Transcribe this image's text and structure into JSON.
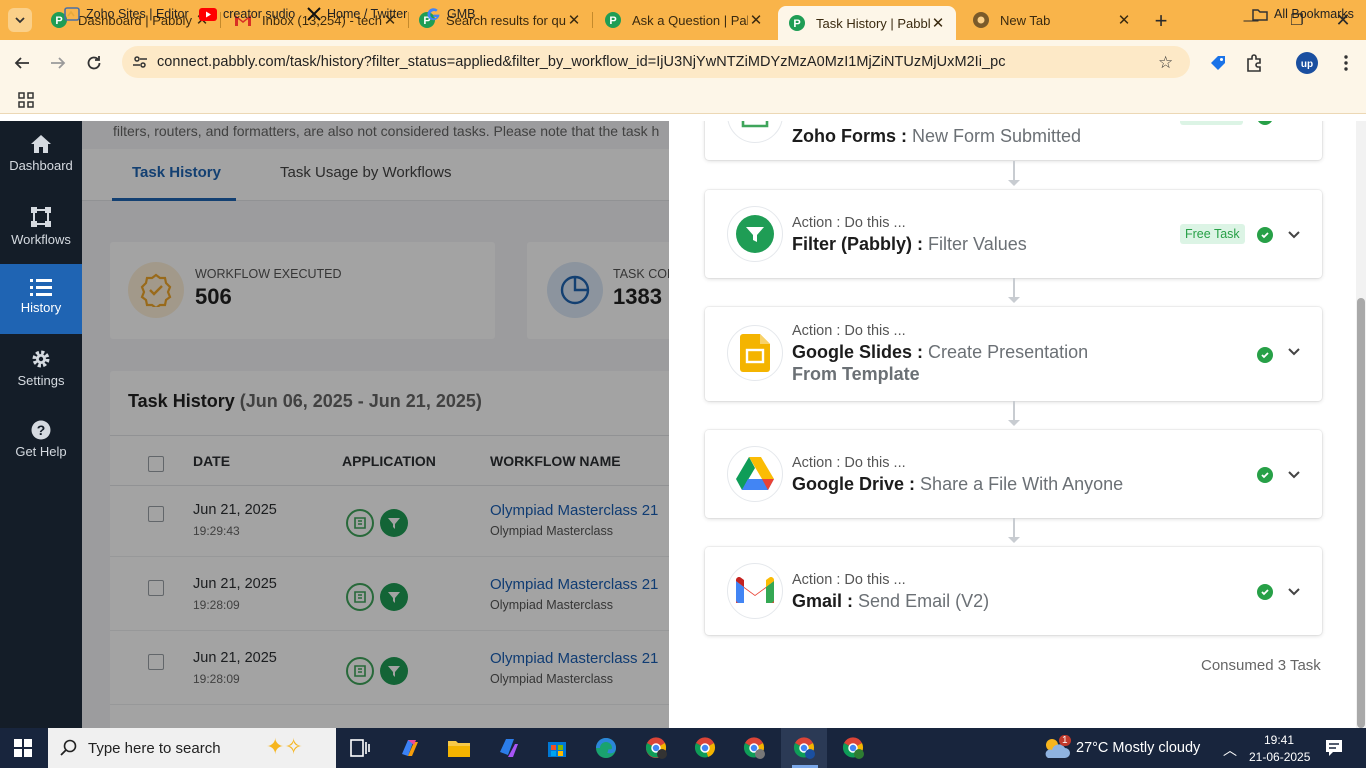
{
  "browser": {
    "tabs": [
      {
        "title": "Dashboard | Pabbly C",
        "icon": "pabbly-icon"
      },
      {
        "title": "Inbox (13,254) - tech",
        "icon": "gmail-icon"
      },
      {
        "title": "Search results for que",
        "icon": "pabbly-icon"
      },
      {
        "title": "Ask a Question | Pabb",
        "icon": "pabbly-icon"
      },
      {
        "title": "Task History | Pabbly",
        "icon": "pabbly-icon"
      },
      {
        "title": "New Tab",
        "icon": "chrome-icon"
      }
    ],
    "url": "connect.pabbly.com/task/history?filter_status=applied&filter_by_workflow_id=IjU3NjYwNTZiMDYzMzA0MzI1MjZiNTUzMjUxM2Ii_pc",
    "bookmarks": [
      "Zoho Sites | Editor",
      "creator sudio",
      "Home / Twitter",
      "GMB"
    ],
    "all_bookmarks": "All Bookmarks"
  },
  "sidebar": {
    "items": [
      {
        "label": "Dashboard"
      },
      {
        "label": "Workflows"
      },
      {
        "label": "History"
      },
      {
        "label": "Settings"
      },
      {
        "label": "Get Help"
      }
    ]
  },
  "page": {
    "intro_text": "filters, routers, and formatters, are also not considered tasks. Please note that the task h",
    "tabs": [
      "Task History",
      "Task Usage by Workflows"
    ],
    "stats": [
      {
        "label": "WORKFLOW EXECUTED",
        "value": "506"
      },
      {
        "label": "TASK CON",
        "value": "1383"
      }
    ],
    "history_title": "Task History",
    "history_range": "(Jun 06, 2025 - Jun 21, 2025)",
    "columns": [
      "DATE",
      "APPLICATION",
      "WORKFLOW NAME"
    ],
    "rows": [
      {
        "date": "Jun 21, 2025",
        "time": "19:29:43",
        "workflow": "Olympiad Masterclass 21",
        "sub": "Olympiad Masterclass"
      },
      {
        "date": "Jun 21, 2025",
        "time": "19:28:09",
        "workflow": "Olympiad Masterclass 21",
        "sub": "Olympiad Masterclass"
      },
      {
        "date": "Jun 21, 2025",
        "time": "19:28:09",
        "workflow": "Olympiad Masterclass 21",
        "sub": "Olympiad Masterclass"
      }
    ]
  },
  "drawer": {
    "steps": [
      {
        "kicker": "",
        "app": "Zoho Forms :",
        "event": "New Form Submitted",
        "badge": "",
        "icon": "zoho-forms-icon"
      },
      {
        "kicker": "Action : Do this ...",
        "app": "Filter (Pabbly) :",
        "event": "Filter Values",
        "badge": "Free Task",
        "icon": "filter-icon"
      },
      {
        "kicker": "Action : Do this ...",
        "app": "Google Slides :",
        "event": "Create Presentation",
        "event2": "From Template",
        "badge": "",
        "icon": "google-slides-icon"
      },
      {
        "kicker": "Action : Do this ...",
        "app": "Google Drive :",
        "event": "Share a File With Anyone",
        "badge": "",
        "icon": "google-drive-icon"
      },
      {
        "kicker": "Action : Do this ...",
        "app": "Gmail :",
        "event": "Send Email (V2)",
        "badge": "",
        "icon": "gmail-icon"
      }
    ],
    "consumed": "Consumed 3 Task"
  },
  "taskbar": {
    "search_placeholder": "Type here to search",
    "weather": "27°C  Mostly cloudy",
    "weather_badge": "1",
    "time": "19:41",
    "date": "21-06-2025"
  },
  "colors": {
    "accent": "#1f64b3",
    "success": "#27a047",
    "tabstrip": "#f9b44a"
  }
}
